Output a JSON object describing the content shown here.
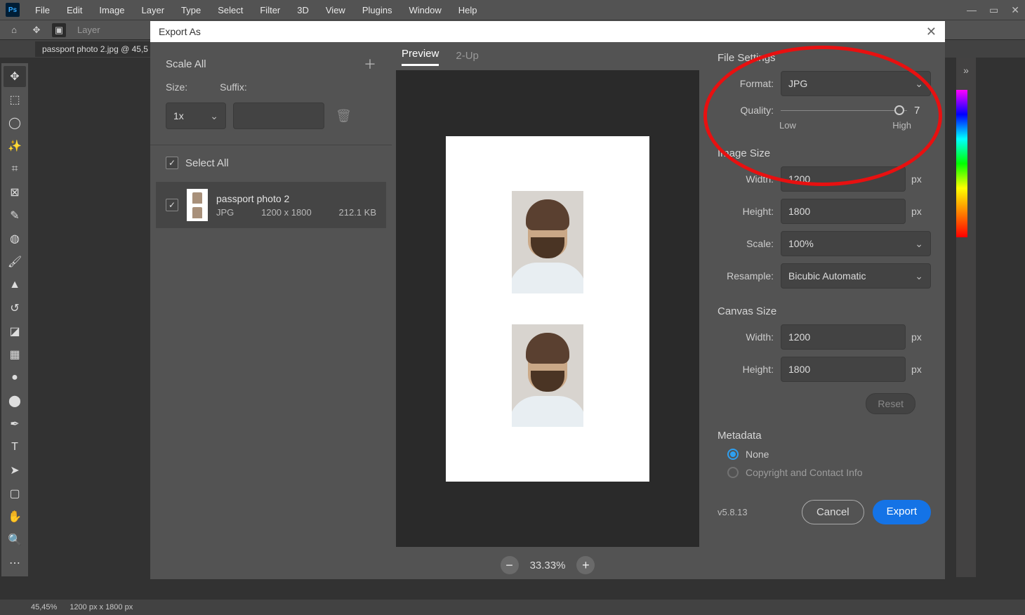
{
  "menu": [
    "File",
    "Edit",
    "Image",
    "Layer",
    "Type",
    "Select",
    "Filter",
    "3D",
    "View",
    "Plugins",
    "Window",
    "Help"
  ],
  "topbar": {
    "layer": "Layer"
  },
  "doc_tab": "passport photo 2.jpg @ 45,5",
  "status": {
    "zoom": "45,45%",
    "dims": "1200 px x 1800 px"
  },
  "modal": {
    "title": "Export As",
    "scale": {
      "title": "Scale All",
      "size_label": "Size:",
      "suffix_label": "Suffix:",
      "size_value": "1x"
    },
    "select_all": "Select All",
    "asset": {
      "name": "passport photo 2",
      "format": "JPG",
      "dims": "1200 x 1800",
      "filesize": "212.1 KB"
    },
    "preview": {
      "tab1": "Preview",
      "tab2": "2-Up",
      "zoom": "33.33%"
    },
    "file_settings": {
      "title": "File Settings",
      "format_label": "Format:",
      "format_value": "JPG",
      "quality_label": "Quality:",
      "quality_value": "7",
      "low": "Low",
      "high": "High"
    },
    "image_size": {
      "title": "Image Size",
      "width_label": "Width:",
      "width_value": "1200",
      "height_label": "Height:",
      "height_value": "1800",
      "scale_label": "Scale:",
      "scale_value": "100%",
      "resample_label": "Resample:",
      "resample_value": "Bicubic Automatic",
      "px": "px"
    },
    "canvas_size": {
      "title": "Canvas Size",
      "width_label": "Width:",
      "width_value": "1200",
      "height_label": "Height:",
      "height_value": "1800",
      "px": "px",
      "reset": "Reset"
    },
    "metadata": {
      "title": "Metadata",
      "none": "None",
      "copyright": "Copyright and Contact Info"
    },
    "footer": {
      "version": "v5.8.13",
      "cancel": "Cancel",
      "export": "Export"
    }
  }
}
